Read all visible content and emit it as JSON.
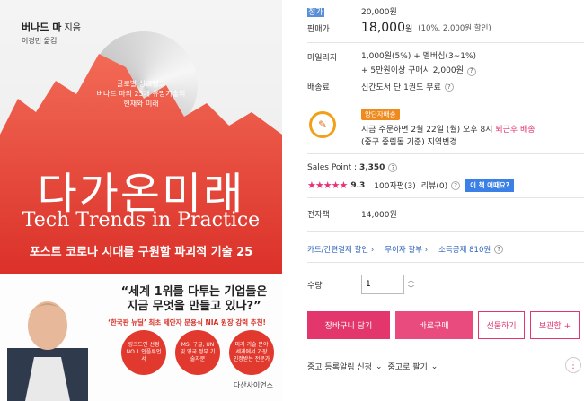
{
  "cover": {
    "author": "버나드 마",
    "author_suffix": "지음",
    "translator": "이경민 옮김",
    "tagline": [
      "글로벌 싱크탱크",
      "버나드 마의 25개 유망기술의",
      "현재와 미래"
    ],
    "title_ko": "다가온미래",
    "title_en": "Tech Trends in Practice",
    "subtitle": "포스트 코로나 시대를 구원할 파괴적 기술 25",
    "quote_line1": "“세계 1위를 다투는 기업들은",
    "quote_line2": "지금 무엇을 만들고 있나?”",
    "promo": "‘한국판 뉴딜’ 최초 제안자 문용식 NIA 원장 강력 추천!",
    "badges": [
      "링크드인 선정 NO.1 인플루언서",
      "MS, 구글, UN 및 영국 정부 기술자문",
      "미래 기술 분야 세계에서 가장 인정받는 전문가"
    ],
    "publisher": "다산사이언스"
  },
  "price": {
    "list_label": "정가",
    "list_value": "20,000원",
    "sale_label": "판매가",
    "sale_number": "18,000",
    "sale_unit": "원",
    "sale_discount": "(10%, 2,000원 할인)"
  },
  "mileage": {
    "label": "마일리지",
    "line1": "1,000원(5%) + 멤버십(3~1%)",
    "line2": "+ 5만원이상 구매시 2,000원"
  },
  "shipping": {
    "label": "배송료",
    "value": "신간도서 단 1권도 무료"
  },
  "delivery": {
    "badge": "양단자배송",
    "line1_prefix": "지금 주문하면 2월 22일 (월) 오후 8시",
    "line1_highlight": "퇴근후 배송",
    "line2": "(중구 중림동 기준) 지역변경"
  },
  "sales_point": {
    "label": "Sales Point :",
    "value": "3,350"
  },
  "rating": {
    "stars": "★★★★★",
    "score": "9.3",
    "review_count": "100자평(3)",
    "review_label": "리뷰(0)",
    "review_btn": "이 책 어때요?"
  },
  "ebook": {
    "label": "전자책",
    "value": "14,000원"
  },
  "links": [
    "카드/간편결제 할인",
    "무이자 할부",
    "소득공제 810원"
  ],
  "quantity": {
    "label": "수량",
    "value": "1"
  },
  "buttons": {
    "cart": "장바구니 담기",
    "buy": "바로구매",
    "gift": "선물하기",
    "keep": "보관함 +"
  },
  "footer": {
    "alert": "중고 등록알림 신청",
    "sell": "중고로 팔기"
  }
}
